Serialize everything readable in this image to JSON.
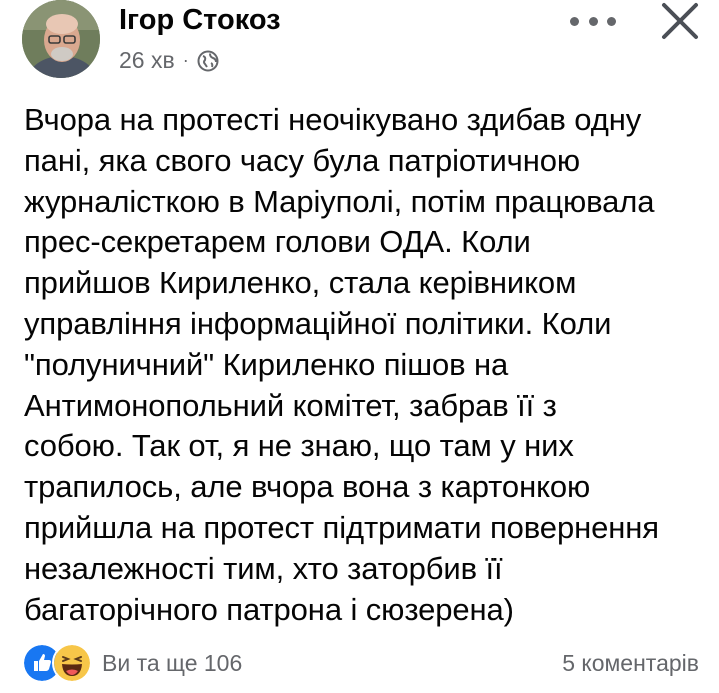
{
  "post": {
    "author": "Ігор Стокоз",
    "time": "26 хв",
    "separator": "·",
    "privacy_icon": "globe-icon",
    "more_icon": "more-horizontal-icon",
    "close_icon": "close-icon",
    "text_lines": [
      "Вчора на протесті неочікувано здибав одну",
      "пані, яка свого часу була патріотичною",
      "журналісткою в Маріуполі, потім працювала",
      "прес-секретарем голови ОДА. Коли",
      "прийшов Кириленко, стала керівником",
      "управління інформаційної політики. Коли",
      "\"полуничний\" Кириленко пішов на",
      "Антимонопольний комітет, забрав її з",
      "собою. Так от, я не знаю, що там у них",
      "трапилось, але вчора вона з картонкою",
      "прийшла на протест підтримати повернення",
      "незалежності тим, хто заторбив її",
      "багаторічного патрона і сюзерена)"
    ],
    "reactions": {
      "icons": [
        "like-icon",
        "haha-icon"
      ],
      "summary": "Ви та ще 106"
    },
    "comments": "5 коментарів"
  },
  "colors": {
    "secondary_text": "#65676b",
    "primary_text": "#050505",
    "like_blue": "#1877f2",
    "haha_yellow": "#f7c649"
  }
}
